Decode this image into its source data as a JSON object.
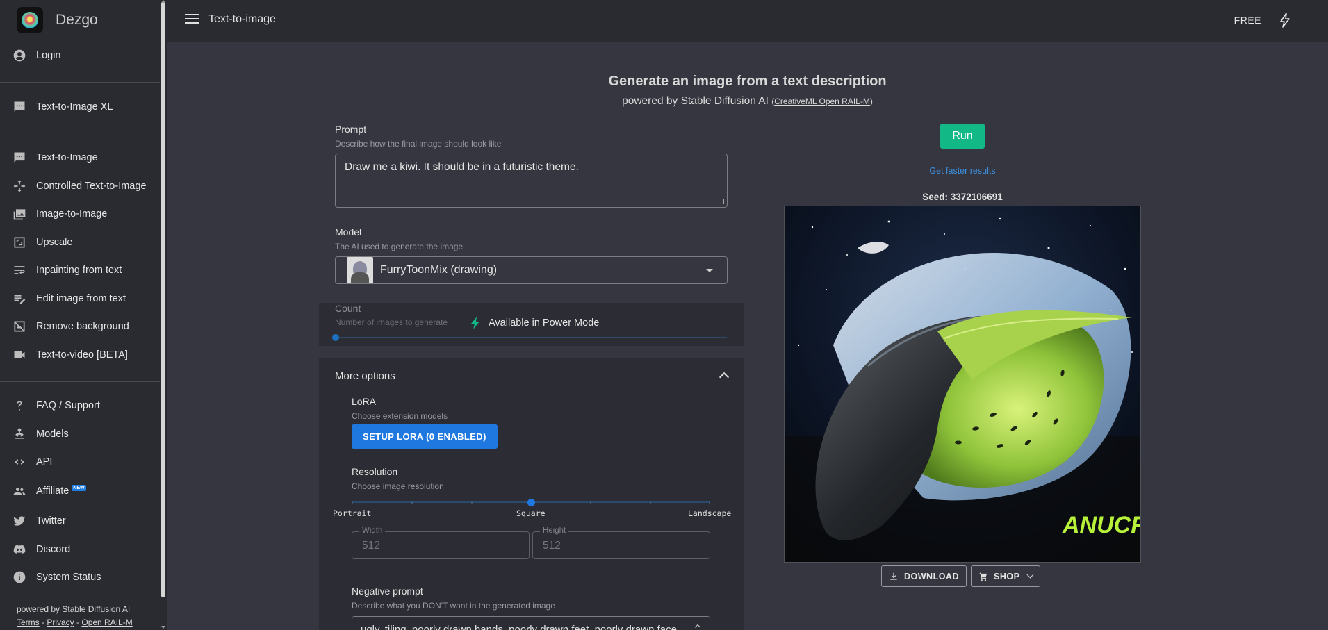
{
  "sidebar": {
    "brand": "Dezgo",
    "login": "Login",
    "items_a": [
      {
        "label": "Text-to-Image XL",
        "icon": "chat-icon"
      }
    ],
    "items_b": [
      {
        "label": "Text-to-Image",
        "icon": "chat-icon"
      },
      {
        "label": "Controlled Text-to-Image",
        "icon": "move-icon"
      },
      {
        "label": "Image-to-Image",
        "icon": "images-icon"
      },
      {
        "label": "Upscale",
        "icon": "upscale-icon"
      },
      {
        "label": "Inpainting from text",
        "icon": "wrap-text-icon"
      },
      {
        "label": "Edit image from text",
        "icon": "edit-note-icon"
      },
      {
        "label": "Remove background",
        "icon": "hide-image-icon"
      },
      {
        "label": "Text-to-video [BETA]",
        "icon": "videocam-icon"
      }
    ],
    "items_c": [
      {
        "label": "FAQ / Support",
        "icon": "question-icon"
      },
      {
        "label": "Models",
        "icon": "models-icon"
      },
      {
        "label": "API",
        "icon": "code-icon"
      },
      {
        "label": "Affiliate",
        "icon": "group-icon",
        "badge": "NEW"
      },
      {
        "label": "Twitter",
        "icon": "twitter-icon"
      },
      {
        "label": "Discord",
        "icon": "discord-icon"
      },
      {
        "label": "System Status",
        "icon": "info-icon"
      }
    ],
    "footer": {
      "powered": "powered by Stable Diffusion AI",
      "terms": "Terms",
      "sep1": " - ",
      "privacy": "Privacy",
      "sep2": " - ",
      "license": "Open RAIL-M"
    }
  },
  "topbar": {
    "title": "Text-to-image",
    "plan": "FREE"
  },
  "hero": {
    "title": "Generate an image from a text description",
    "sub_prefix": "powered by Stable Diffusion AI ",
    "sub_open": "(",
    "sub_link": "CreativeML Open RAIL-M",
    "sub_close": ")"
  },
  "prompt": {
    "label": "Prompt",
    "hint": "Describe how the final image should look like",
    "value": "Draw me a kiwi. It should be in a futuristic theme."
  },
  "model": {
    "label": "Model",
    "hint": "The AI used to generate the image.",
    "selected": "FurryToonMix (drawing)"
  },
  "count": {
    "label": "Count",
    "hint": "Number of images to generate",
    "power_text": "Available in Power Mode"
  },
  "more_options": {
    "title": "More options",
    "lora_label": "LoRA",
    "lora_hint": "Choose extension models",
    "lora_button": "SETUP LORA (0 ENABLED)",
    "resolution_label": "Resolution",
    "resolution_hint": "Choose image resolution",
    "res_portrait": "Portrait",
    "res_square": "Square",
    "res_landscape": "Landscape",
    "width_label": "Width",
    "width_value": "512",
    "height_label": "Height",
    "height_value": "512",
    "negative_label": "Negative prompt",
    "negative_hint": "Describe what you DON'T want in the generated image",
    "negative_value": "ugly, tiling, poorly drawn hands, poorly drawn feet, poorly drawn face"
  },
  "result": {
    "run": "Run",
    "faster": "Get faster results",
    "seed": "Seed: 3372106691",
    "download": "DOWNLOAD",
    "shop": "SHOP",
    "signature": "ANUCR"
  },
  "colors": {
    "run_green": "#12b886",
    "accent_blue": "#1e78e0",
    "link_blue": "#3d8fe0",
    "bg": "#35363f",
    "panel": "#2a2b31"
  }
}
